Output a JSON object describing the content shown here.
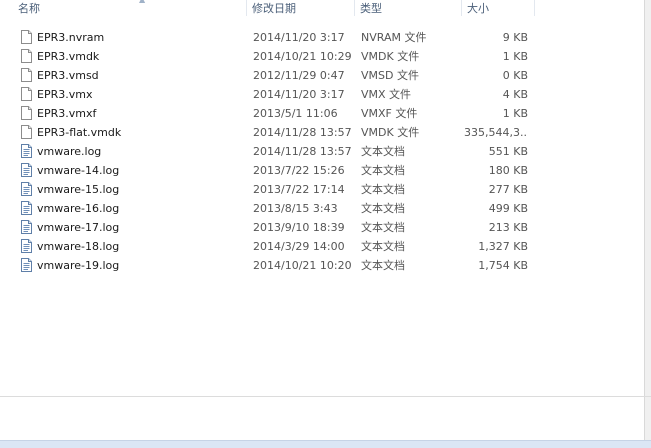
{
  "columns": {
    "name": "名称",
    "date": "修改日期",
    "type": "类型",
    "size": "大小"
  },
  "sort": {
    "column": "name",
    "icon": "sort-arrow-icon"
  },
  "files": [
    {
      "name": "EPR3.nvram",
      "date": "2014/11/20 3:17",
      "type": "NVRAM 文件",
      "size": "9 KB",
      "icon": "generic-file-icon"
    },
    {
      "name": "EPR3.vmdk",
      "date": "2014/10/21 10:29",
      "type": "VMDK 文件",
      "size": "1 KB",
      "icon": "generic-file-icon"
    },
    {
      "name": "EPR3.vmsd",
      "date": "2012/11/29 0:47",
      "type": "VMSD 文件",
      "size": "0 KB",
      "icon": "generic-file-icon"
    },
    {
      "name": "EPR3.vmx",
      "date": "2014/11/20 3:17",
      "type": "VMX 文件",
      "size": "4 KB",
      "icon": "generic-file-icon"
    },
    {
      "name": "EPR3.vmxf",
      "date": "2013/5/1 11:06",
      "type": "VMXF 文件",
      "size": "1 KB",
      "icon": "generic-file-icon"
    },
    {
      "name": "EPR3-flat.vmdk",
      "date": "2014/11/28 13:57",
      "type": "VMDK 文件",
      "size": "335,544,3...",
      "icon": "generic-file-icon"
    },
    {
      "name": "vmware.log",
      "date": "2014/11/28 13:57",
      "type": "文本文档",
      "size": "551 KB",
      "icon": "text-document-icon"
    },
    {
      "name": "vmware-14.log",
      "date": "2013/7/22 15:26",
      "type": "文本文档",
      "size": "180 KB",
      "icon": "text-document-icon"
    },
    {
      "name": "vmware-15.log",
      "date": "2013/7/22 17:14",
      "type": "文本文档",
      "size": "277 KB",
      "icon": "text-document-icon"
    },
    {
      "name": "vmware-16.log",
      "date": "2013/8/15 3:43",
      "type": "文本文档",
      "size": "499 KB",
      "icon": "text-document-icon"
    },
    {
      "name": "vmware-17.log",
      "date": "2013/9/10 18:39",
      "type": "文本文档",
      "size": "213 KB",
      "icon": "text-document-icon"
    },
    {
      "name": "vmware-18.log",
      "date": "2014/3/29 14:00",
      "type": "文本文档",
      "size": "1,327 KB",
      "icon": "text-document-icon"
    },
    {
      "name": "vmware-19.log",
      "date": "2014/10/21 10:20",
      "type": "文本文档",
      "size": "1,754 KB",
      "icon": "text-document-icon"
    }
  ]
}
